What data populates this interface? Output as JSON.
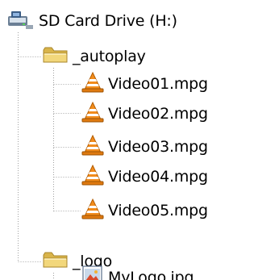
{
  "tree": {
    "root": {
      "label": "SD Card Drive (H:)",
      "icon": "removable-drive-icon"
    },
    "folders": [
      {
        "label": "_autoplay",
        "icon": "folder-icon",
        "files": [
          {
            "label": "Video01.mpg",
            "icon": "vlc-cone-icon"
          },
          {
            "label": "Video02.mpg",
            "icon": "vlc-cone-icon"
          },
          {
            "label": "Video03.mpg",
            "icon": "vlc-cone-icon"
          },
          {
            "label": "Video04.mpg",
            "icon": "vlc-cone-icon"
          },
          {
            "label": "Video05.mpg",
            "icon": "vlc-cone-icon"
          }
        ]
      },
      {
        "label": "_logo",
        "icon": "folder-icon",
        "files": [
          {
            "label": "MyLogo.jpg",
            "icon": "image-file-icon"
          }
        ]
      }
    ]
  },
  "colors": {
    "folder": "#f2d77b",
    "vlc_orange": "#f28c1c",
    "guide": "#a0a0a0"
  }
}
